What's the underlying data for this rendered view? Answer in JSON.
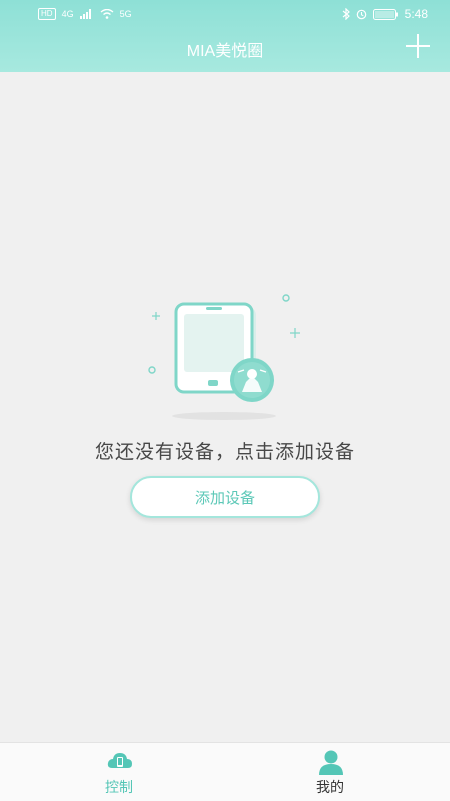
{
  "status_bar": {
    "left_chip": "HD",
    "network": "4G",
    "wifi_extra": "5G",
    "battery": "100",
    "time": "5:48"
  },
  "header": {
    "title": "MIA美悦圈",
    "add_icon": "plus-icon"
  },
  "empty_state": {
    "illustration": "phone-device-icon",
    "message": "您还没有设备，点击添加设备",
    "button_label": "添加设备"
  },
  "tabs": [
    {
      "label": "控制",
      "icon": "cloud-phone-icon",
      "active": true
    },
    {
      "label": "我的",
      "icon": "user-icon",
      "active": false
    }
  ],
  "colors": {
    "accent": "#54c6b6",
    "header_bg": "#9fe6dc",
    "page_bg": "#f0f0f0",
    "text": "#474747"
  }
}
